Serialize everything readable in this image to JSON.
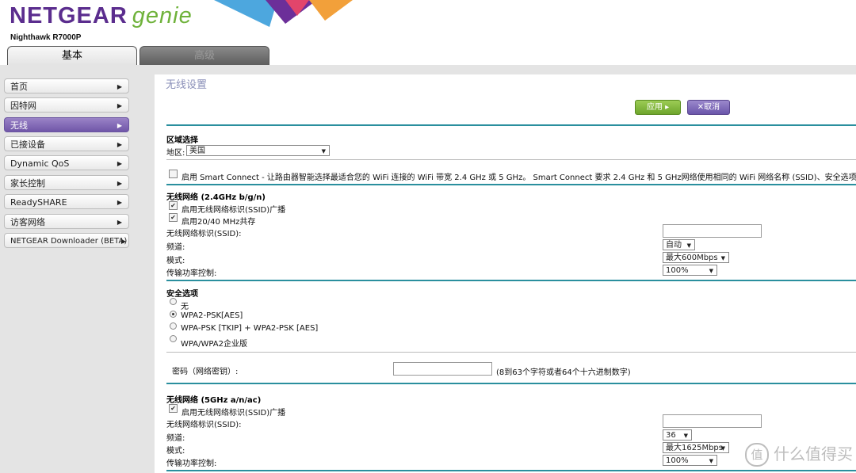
{
  "brand": {
    "name": "NETGEAR",
    "product": "genie",
    "model": "Nighthawk R7000P"
  },
  "tabs": [
    {
      "label": "基本"
    },
    {
      "label": "高级"
    }
  ],
  "sidebar": {
    "items": [
      {
        "label": "首页"
      },
      {
        "label": "因特网"
      },
      {
        "label": "无线"
      },
      {
        "label": "已接设备"
      },
      {
        "label": "Dynamic QoS"
      },
      {
        "label": "家长控制"
      },
      {
        "label": "ReadySHARE"
      },
      {
        "label": "访客网络"
      },
      {
        "label": "NETGEAR Downloader (BETA)"
      }
    ],
    "active": "无线"
  },
  "page": {
    "title": "无线设置"
  },
  "toolbar": {
    "apply": "应用 ▸",
    "cancel": "✕取消"
  },
  "region": {
    "heading": "区域选择",
    "label": "地区:",
    "value": "美国"
  },
  "smart_connect": {
    "text": "启用 Smart Connect - 让路由器智能选择最适合您的 WiFi 连接的 WiFi 带宽 2.4 GHz 或 5 GHz。 Smart Connect 要求 2.4 GHz 和 5 GHz网络使用相同的 WiFi 网络名称 (SSID)、安全选项和密码。",
    "checked": false
  },
  "wifi24": {
    "heading": "无线网络 (2.4GHz b/g/n)",
    "ssid_broadcast": "启用无线网络标识(SSID)广播",
    "coexist": "启用20/40 MHz共存",
    "ssid_label": "无线网络标识(SSID):",
    "ssid_value": "",
    "channel_label": "频道:",
    "channel_value": "自动",
    "mode_label": "模式:",
    "mode_value": "最大600Mbps",
    "power_label": "传输功率控制:",
    "power_value": "100%"
  },
  "security": {
    "heading": "安全选项",
    "options": [
      {
        "label": "无"
      },
      {
        "label": "WPA2-PSK[AES]"
      },
      {
        "label": "WPA-PSK [TKIP] + WPA2-PSK [AES]"
      },
      {
        "label": "WPA/WPA2企业版"
      }
    ],
    "selected": "WPA2-PSK[AES]",
    "password_label": "密码（网络密钥）:",
    "password_value": "",
    "password_hint": "(8到63个字符或者64个十六进制数字)"
  },
  "wifi5": {
    "heading": "无线网络 (5GHz a/n/ac)",
    "ssid_broadcast": "启用无线网络标识(SSID)广播",
    "ssid_label": "无线网络标识(SSID):",
    "ssid_value": "",
    "channel_label": "频道:",
    "channel_value": "36",
    "mode_label": "模式:",
    "mode_value": "最大1625Mbps",
    "power_label": "传输功率控制:",
    "power_value": "100%"
  },
  "watermark": {
    "text": "什么值得买",
    "icon": "值"
  }
}
